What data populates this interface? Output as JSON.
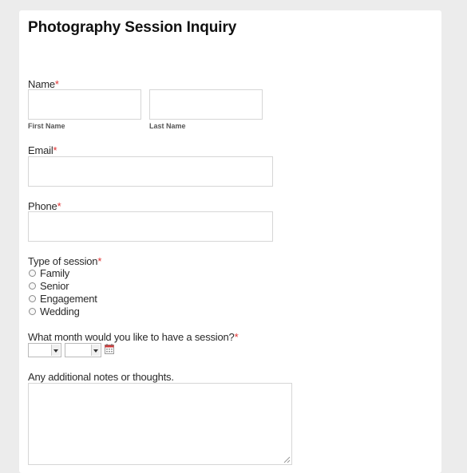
{
  "form": {
    "title": "Photography Session Inquiry",
    "required_mark": "*",
    "name": {
      "label": "Name",
      "first_sublabel": "First Name",
      "last_sublabel": "Last Name",
      "first_value": "",
      "last_value": ""
    },
    "email": {
      "label": "Email",
      "value": ""
    },
    "phone": {
      "label": "Phone",
      "value": ""
    },
    "session_type": {
      "label": "Type of session",
      "options": [
        "Family",
        "Senior",
        "Engagement",
        "Wedding"
      ]
    },
    "month": {
      "label": "What month would you like to have a session?",
      "month_selected": "",
      "year_selected": "",
      "icon": "calendar-icon"
    },
    "notes": {
      "label": "Any additional notes or thoughts.",
      "value": ""
    }
  },
  "colors": {
    "background": "#ececec",
    "card": "#ffffff",
    "required": "#e03030",
    "input_border": "#d6d6d6"
  }
}
